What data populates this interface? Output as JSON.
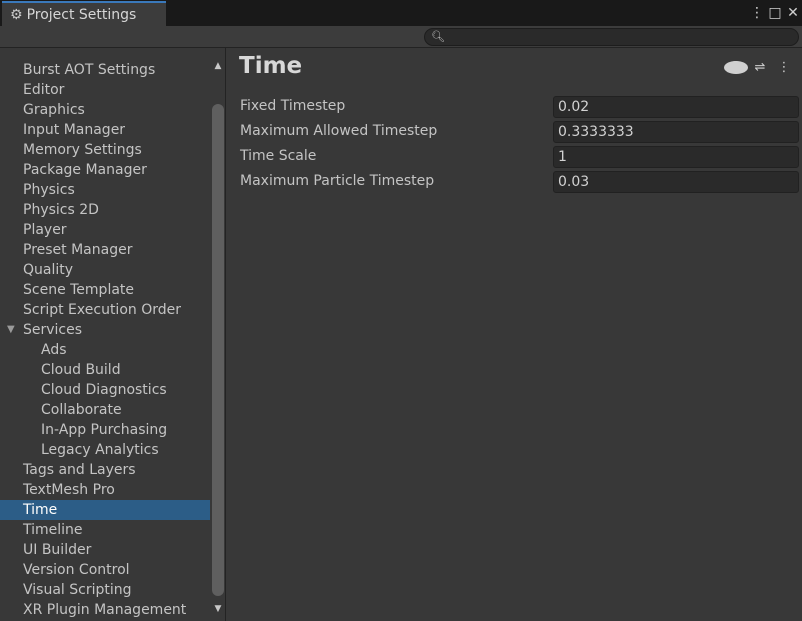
{
  "window": {
    "tab_title": "Project Settings",
    "tab_icon": "gear-icon",
    "controls": [
      "more-icon",
      "maximize-icon",
      "close-icon"
    ]
  },
  "search": {
    "value": "",
    "placeholder": ""
  },
  "sidebar": {
    "items": [
      {
        "label": "Burst AOT Settings",
        "child": false,
        "selected": false
      },
      {
        "label": "Editor",
        "child": false,
        "selected": false
      },
      {
        "label": "Graphics",
        "child": false,
        "selected": false
      },
      {
        "label": "Input Manager",
        "child": false,
        "selected": false
      },
      {
        "label": "Memory Settings",
        "child": false,
        "selected": false
      },
      {
        "label": "Package Manager",
        "child": false,
        "selected": false
      },
      {
        "label": "Physics",
        "child": false,
        "selected": false
      },
      {
        "label": "Physics 2D",
        "child": false,
        "selected": false
      },
      {
        "label": "Player",
        "child": false,
        "selected": false
      },
      {
        "label": "Preset Manager",
        "child": false,
        "selected": false
      },
      {
        "label": "Quality",
        "child": false,
        "selected": false
      },
      {
        "label": "Scene Template",
        "child": false,
        "selected": false
      },
      {
        "label": "Script Execution Order",
        "child": false,
        "selected": false
      },
      {
        "label": "Services",
        "child": false,
        "selected": false,
        "expanded": true
      },
      {
        "label": "Ads",
        "child": true,
        "selected": false
      },
      {
        "label": "Cloud Build",
        "child": true,
        "selected": false
      },
      {
        "label": "Cloud Diagnostics",
        "child": true,
        "selected": false
      },
      {
        "label": "Collaborate",
        "child": true,
        "selected": false
      },
      {
        "label": "In-App Purchasing",
        "child": true,
        "selected": false
      },
      {
        "label": "Legacy Analytics",
        "child": true,
        "selected": false
      },
      {
        "label": "Tags and Layers",
        "child": false,
        "selected": false
      },
      {
        "label": "TextMesh Pro",
        "child": false,
        "selected": false
      },
      {
        "label": "Time",
        "child": false,
        "selected": true
      },
      {
        "label": "Timeline",
        "child": false,
        "selected": false
      },
      {
        "label": "UI Builder",
        "child": false,
        "selected": false
      },
      {
        "label": "Version Control",
        "child": false,
        "selected": false
      },
      {
        "label": "Visual Scripting",
        "child": false,
        "selected": false
      },
      {
        "label": "XR Plugin Management",
        "child": false,
        "selected": false
      }
    ]
  },
  "main": {
    "title": "Time",
    "header_icons": [
      "help-icon",
      "preset-icon",
      "more-icon"
    ],
    "properties": [
      {
        "label": "Fixed Timestep",
        "value": "0.02"
      },
      {
        "label": "Maximum Allowed Timestep",
        "value": "0.3333333"
      },
      {
        "label": "Time Scale",
        "value": "1"
      },
      {
        "label": "Maximum Particle Timestep",
        "value": "0.03"
      }
    ]
  },
  "colors": {
    "selection": "#2c5d87",
    "tab_accent": "#3a79bb",
    "panel_bg": "#383838"
  }
}
